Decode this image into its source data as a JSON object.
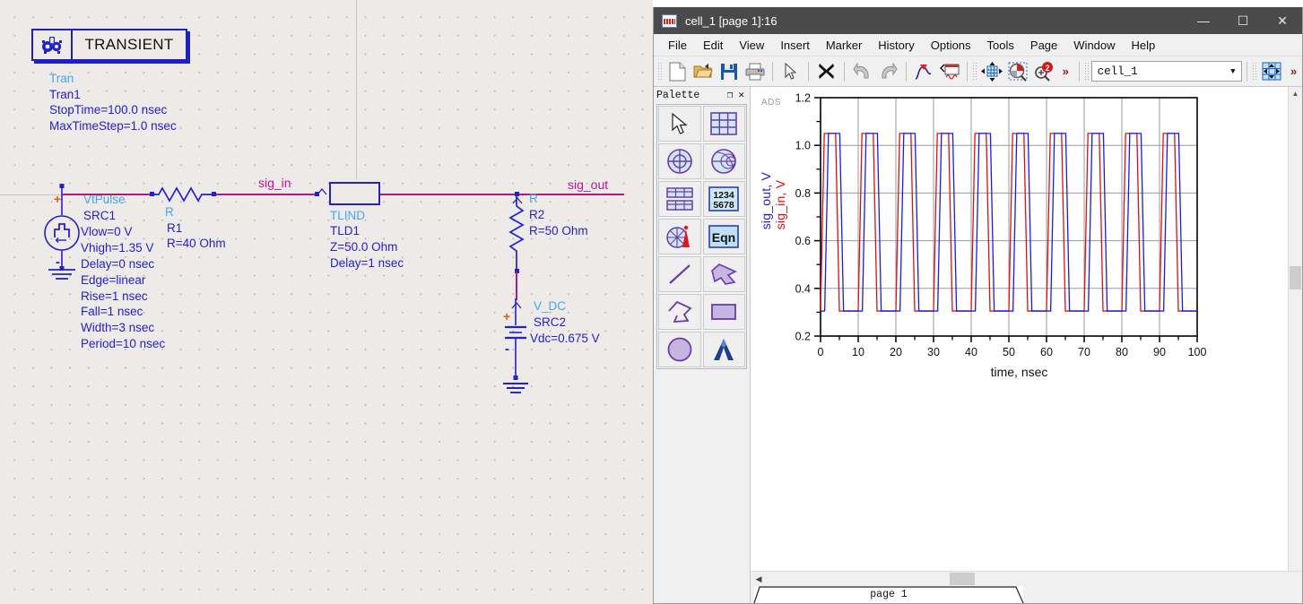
{
  "schematic": {
    "tran_block": {
      "title": "TRANSIENT",
      "icon": "gears-icon",
      "type": "Tran",
      "instance": "Tran1",
      "params": [
        "StopTime=100.0 nsec",
        "MaxTimeStep=1.0 nsec"
      ]
    },
    "source": {
      "type": "VtPulse",
      "instance": "SRC1",
      "plus": "+",
      "minus": "-",
      "params": [
        "Vlow=0 V",
        "Vhigh=1.35 V",
        "Delay=0 nsec",
        "Edge=linear",
        "Rise=1 nsec",
        "Fall=1 nsec",
        "Width=3 nsec",
        "Period=10 nsec"
      ]
    },
    "resistor1": {
      "type": "R",
      "instance": "R1",
      "value": "R=40 Ohm"
    },
    "tline": {
      "type": "TLIND",
      "instance": "TLD1",
      "params": [
        "Z=50.0 Ohm",
        "Delay=1 nsec"
      ]
    },
    "resistor2": {
      "type": "R",
      "instance": "R2",
      "value": "R=50 Ohm"
    },
    "vdc": {
      "type": "V_DC",
      "instance": "SRC2",
      "value": "Vdc=0.675 V",
      "plus": "+",
      "minus": "-"
    },
    "net_labels": {
      "input": "sig_in",
      "output": "sig_out"
    },
    "colors": {
      "wire": "#b01a7a",
      "component": "#2222cc",
      "type_label": "#3fa9f5",
      "net_label": "#c2158c",
      "polarity": "#e06000",
      "canvas": "#edeae7"
    }
  },
  "window": {
    "title": "cell_1 [page 1]:16",
    "icon": "waveform-icon",
    "controls": {
      "minimize": "—",
      "maximize": "☐",
      "close": "✕"
    },
    "menu": [
      "File",
      "Edit",
      "View",
      "Insert",
      "Marker",
      "History",
      "Options",
      "Tools",
      "Page",
      "Window",
      "Help"
    ],
    "toolbar": {
      "icons": [
        "new-document-icon",
        "open-folder-icon",
        "save-icon",
        "print-icon",
        "select-arrow-icon",
        "delete-x-icon",
        "undo-icon",
        "redo-icon",
        "insert-trace-icon",
        "insert-plot-icon",
        "pan-icon",
        "zoom-area-icon",
        "zoom-in-icon"
      ],
      "overflow": "»",
      "overflow2": "»",
      "combo_value": "cell_1",
      "combo_arrow": "▼",
      "grid_icon": "grid-move-icon"
    },
    "palette": {
      "title": "Palette",
      "float_icon": "❐",
      "close_icon": "✕",
      "items": [
        "select-arrow-tool",
        "rect-grid-tool",
        "polar-plot-tool",
        "smith-chart-tool",
        "list-table-tool",
        "numeric-table-tool",
        "antenna-pattern-tool",
        "equation-tool",
        "line-tool",
        "arrow-polyline-tool",
        "polyline-tool",
        "rectangle-tool",
        "circle-tool",
        "text-tool"
      ],
      "eqn_label": "Eqn",
      "numbers_label_1": "1234",
      "numbers_label_2": "5678",
      "text_label": "A"
    },
    "statusbar": {
      "page_tab": "page 1"
    },
    "watermark": "ADS"
  },
  "chart_data": {
    "type": "line",
    "title": "",
    "xlabel": "time, nsec",
    "ylabel": "sig_out, V / sig_in, V",
    "ylabel_parts": [
      {
        "text": "sig_out, V",
        "color": "#1a1aee"
      },
      {
        "text": "sig_in, V",
        "color": "#e01010"
      }
    ],
    "xlim": [
      0,
      100
    ],
    "ylim": [
      0.2,
      1.2
    ],
    "xticks": [
      0,
      10,
      20,
      30,
      40,
      50,
      60,
      70,
      80,
      90,
      100
    ],
    "yticks": [
      0.2,
      0.4,
      0.6,
      0.8,
      1.0,
      1.2
    ],
    "y_minor_count": 1,
    "grid": true,
    "legend": "none",
    "vlow": 0.305,
    "vhigh": 1.05,
    "period": 10,
    "width": 3,
    "rise": 1,
    "fall": 1,
    "n_pulses": 10,
    "series": [
      {
        "name": "sig_in, V",
        "color": "#e01010",
        "delay": 0,
        "description": "Input pulse train at source: low 0.305 V, high 1.05 V, period 10 nsec, width 3 nsec, 1 nsec rise/fall"
      },
      {
        "name": "sig_out, V",
        "color": "#1a1aee",
        "delay": 1.1,
        "description": "Output after 1 nsec transmission line delay, slightly rounded edges"
      }
    ]
  }
}
